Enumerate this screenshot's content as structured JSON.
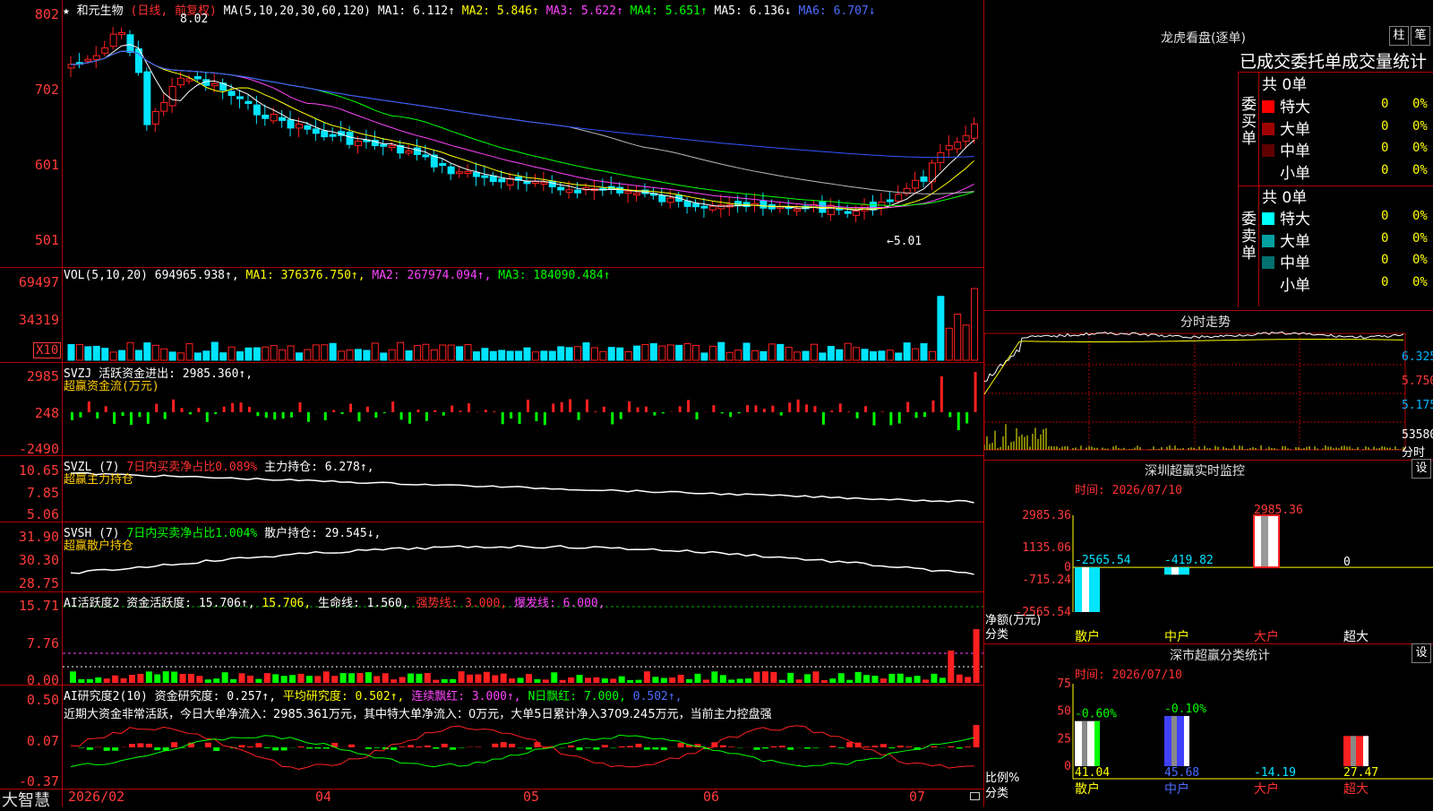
{
  "colors": {
    "up": "#ff2020",
    "down": "#00e5ff",
    "grid": "#b00000"
  },
  "stock": {
    "star": "★",
    "name": "和元生物",
    "period": "(日线, 前复权)"
  },
  "price_axis": [
    "802",
    "702",
    "601",
    "501"
  ],
  "ma_header": {
    "params": "MA(5,10,20,30,60,120)",
    "ma1": "MA1: 6.112↑",
    "ma2": "MA2: 5.846↑",
    "ma3": "MA3: 5.622↑",
    "ma4": "MA4: 5.651↑",
    "ma5": "MA5: 6.136↓",
    "ma6": "MA6: 6.707↓"
  },
  "price_marks": {
    "high": "8.02",
    "low": "←5.01"
  },
  "vol": {
    "header_prefix": "VOL(5,10,20) 694965.938↑,",
    "ma1": "MA1: 376376.750↑,",
    "ma2": "MA2: 267974.094↑,",
    "ma3": "MA3: 184090.484↑",
    "axis": [
      "69497",
      "34319"
    ],
    "unit": "X10"
  },
  "svzj": {
    "header": "SVZJ  活跃资金进出: 2985.360↑,",
    "sub": "超赢资金流(万元)",
    "axis": [
      "2985",
      "248",
      "-2490"
    ]
  },
  "svzl": {
    "header_a": "SVZL (7)",
    "header_b": "7日内买卖净占比0.089%",
    "header_c": "主力持仓: 6.278↑,",
    "sub": "超赢主力持仓",
    "axis": [
      "10.65",
      "7.85",
      "5.06"
    ]
  },
  "svsh": {
    "header_a": "SVSH (7)",
    "header_b": "7日内买卖净占比1.004%",
    "header_c": "散户持仓: 29.545↓,",
    "sub": "超赢散户持仓",
    "axis": [
      "31.90",
      "30.30",
      "28.75"
    ]
  },
  "ai1": {
    "header_a": "AI活跃度2 资金活跃度: 15.706↑,",
    "header_b": "15.706,",
    "header_c": "生命线: 1.560,",
    "header_d": "强势线: 3.000,",
    "header_e": "爆发线: 6.000,",
    "axis": [
      "15.71",
      "7.76",
      "0.00"
    ]
  },
  "ai2": {
    "header_a": "AI研究度2(10)",
    "header_b": "资金研究度: 0.257↑,",
    "header_c": "平均研究度: 0.502↑,",
    "header_d": "连续飘红: 3.000↑,",
    "header_e": "N日飘红: 7.000,",
    "header_f": "0.502↑,",
    "note": "近期大资金非常活跃，今日大单净流入：2985.361万元，其中特大单净流入：0万元，大单5日累计净入3709.245万元，当前主力控盘强",
    "axis": [
      "0.50",
      "0.07",
      "-0.37"
    ]
  },
  "x_axis": [
    "2026/02",
    "04",
    "05",
    "06",
    "07"
  ],
  "footer": "大智慧",
  "right": {
    "dragon_title": "龙虎看盘(逐单)",
    "tab_zhu": "柱",
    "tab_bi": "笔",
    "order_header": "已成交委托单成交量统计",
    "buy_label": "委买单",
    "sell_label": "委卖单",
    "buy_total": "共 0单",
    "sell_total": "共 0单",
    "buy_rows": [
      {
        "name": "特大",
        "count": "0",
        "pct": "0%",
        "color": "#ff0000"
      },
      {
        "name": "大单",
        "count": "0",
        "pct": "0%",
        "color": "#a00000"
      },
      {
        "name": "中单",
        "count": "0",
        "pct": "0%",
        "color": "#600000"
      },
      {
        "name": "小单",
        "count": "0",
        "pct": "0%",
        "color": "#000000"
      }
    ],
    "sell_rows": [
      {
        "name": "特大",
        "count": "0",
        "pct": "0%",
        "color": "#00ffff"
      },
      {
        "name": "大单",
        "count": "0",
        "pct": "0%",
        "color": "#00a0a0"
      },
      {
        "name": "中单",
        "count": "0",
        "pct": "0%",
        "color": "#007070"
      },
      {
        "name": "小单",
        "count": "0",
        "pct": "0%",
        "color": "#000000"
      }
    ],
    "intraday_title": "分时走势",
    "intraday_axis": [
      "6.325",
      "5.750",
      "5.175",
      "53580"
    ],
    "intraday_unit": "分时",
    "sz_monitor_title": "深圳超赢实时监控",
    "sz_monitor_time": "时间: 2026/07/10",
    "sz_monitor_axis": [
      "2985.36",
      "1135.06",
      "0",
      "-715.24",
      "-2565.54"
    ],
    "sz_monitor_ylab": "净额(万元)",
    "sz_monitor_ylab2": "分类",
    "sz_monitor_bars": [
      {
        "cat": "散户",
        "value": -2565.54,
        "label": "-2565.54"
      },
      {
        "cat": "中户",
        "value": -419.82,
        "label": "-419.82"
      },
      {
        "cat": "大户",
        "value": 2985.36,
        "label": "2985.36"
      },
      {
        "cat": "超大",
        "value": 0,
        "label": "0"
      }
    ],
    "sz_class_title": "深市超赢分类统计",
    "sz_class_time": "时间: 2026/07/10",
    "sz_class_axis": [
      "75",
      "50",
      "25",
      "0"
    ],
    "sz_class_ylab": "比例%",
    "sz_class_ylab2": "分类",
    "sz_class_bars": [
      {
        "cat": "散户",
        "value": 41.04,
        "top": "-0.60%",
        "bottom": "41.04"
      },
      {
        "cat": "中户",
        "value": 45.68,
        "top": "-0.10%",
        "bottom": "45.68"
      },
      {
        "cat": "大户",
        "value": -14.19,
        "top": "",
        "bottom": "-14.19"
      },
      {
        "cat": "超大",
        "value": 27.47,
        "top": "",
        "bottom": "27.47"
      }
    ],
    "settings_label": "设"
  }
}
